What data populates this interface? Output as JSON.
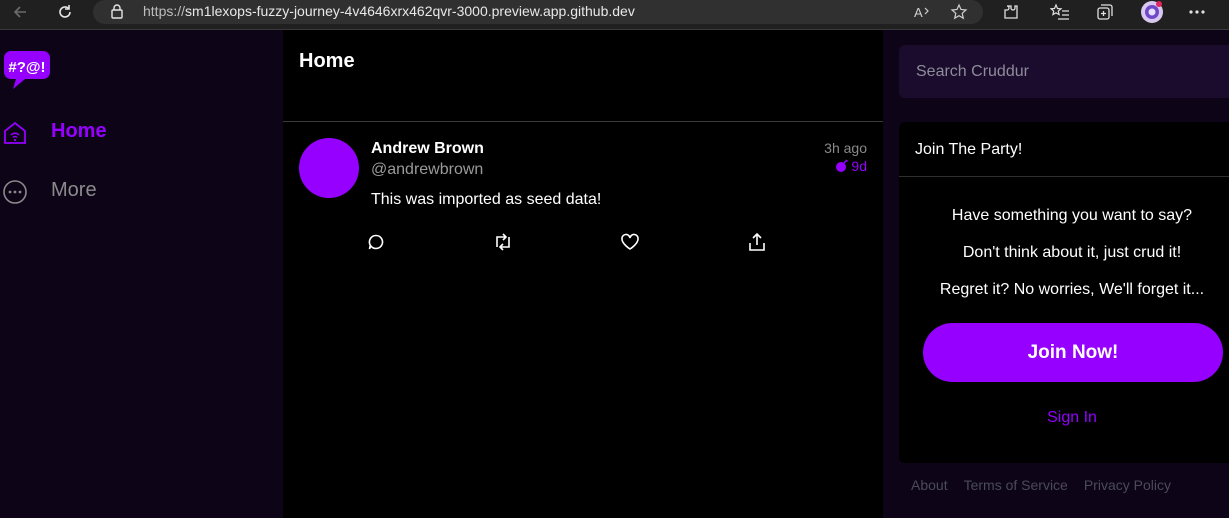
{
  "browser": {
    "url_prefix": "https://",
    "url_host": "sm1lexops-fuzzy-journey-4v4646xrx462qvr-3000.preview.app.github.dev"
  },
  "sidebar": {
    "logo_text": "#?@!",
    "items": [
      {
        "label": "Home",
        "icon": "home-icon",
        "active": true
      },
      {
        "label": "More",
        "icon": "more-icon",
        "active": false
      }
    ]
  },
  "feed": {
    "title": "Home",
    "activities": [
      {
        "display_name": "Andrew Brown",
        "handle": "@andrewbrown",
        "time_ago": "3h ago",
        "expires": "9d",
        "message": "This was imported as seed data!"
      }
    ]
  },
  "right": {
    "search_placeholder": "Search Cruddur",
    "join": {
      "title": "Join The Party!",
      "lines": [
        "Have something you want to say?",
        "Don't think about it, just crud it!",
        "Regret it? No worries, We'll forget it..."
      ],
      "button_label": "Join Now!",
      "sign_in_label": "Sign In"
    },
    "footer": [
      "About",
      "Terms of Service",
      "Privacy Policy"
    ]
  },
  "colors": {
    "accent": "#9500ff",
    "sidebar_bg": "#0d0417",
    "feed_bg": "#000000"
  }
}
